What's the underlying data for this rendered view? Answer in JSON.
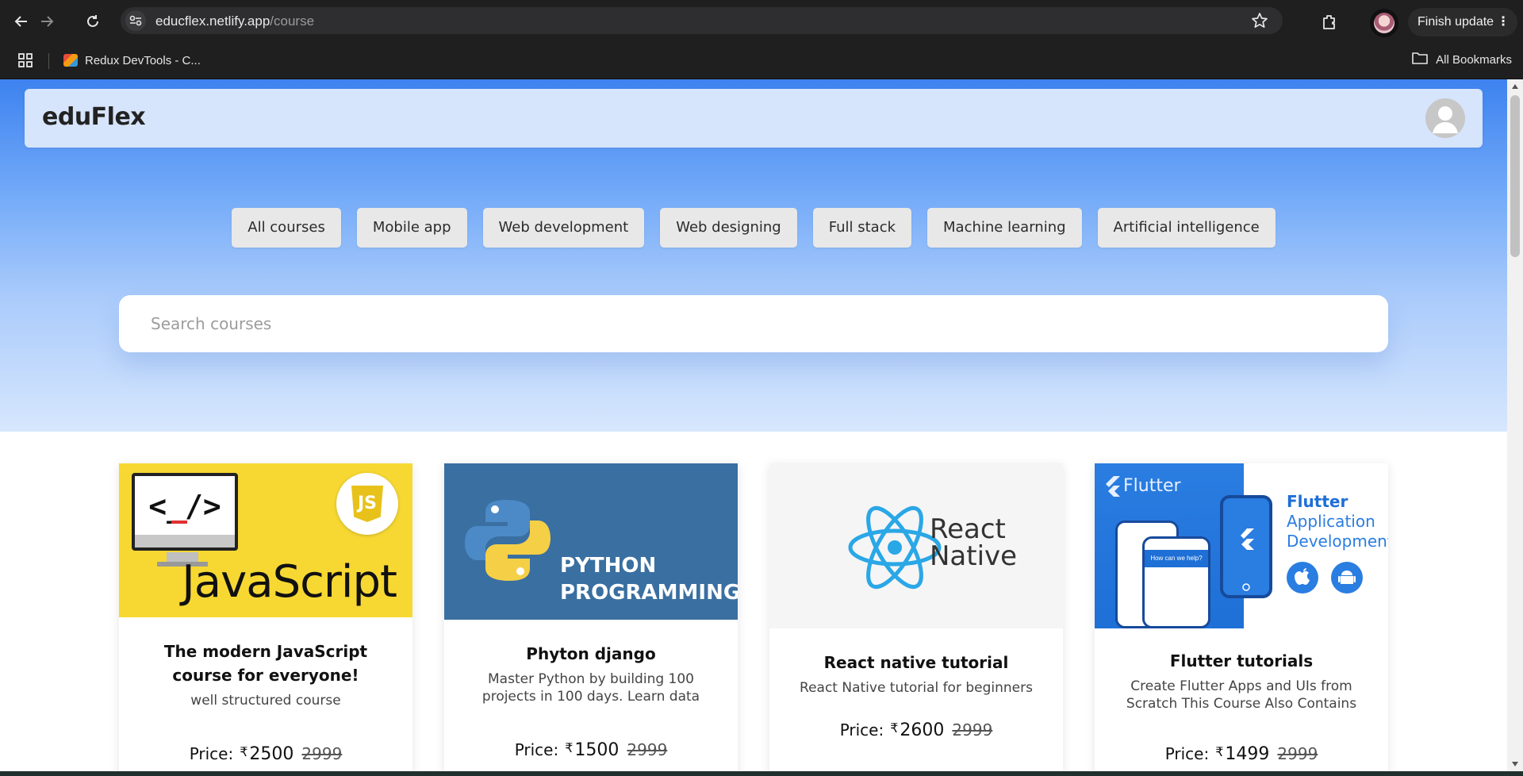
{
  "browser": {
    "url_host": "educflex.netlify.app",
    "url_path": "/course",
    "finish_update_label": "Finish update",
    "bookmark_item": "Redux DevTools - C...",
    "all_bookmarks_label": "All Bookmarks"
  },
  "header": {
    "brand": "eduFlex"
  },
  "categories": [
    "All courses",
    "Mobile app",
    "Web development",
    "Web designing",
    "Full stack",
    "Machine learning",
    "Artificial intelligence"
  ],
  "search": {
    "placeholder": "Search courses",
    "value": ""
  },
  "courses": [
    {
      "title": "The modern JavaScript course for everyone!",
      "description": "well structured course",
      "price_label": "Price:",
      "currency": "₹",
      "price": "2500",
      "old_price": "2999",
      "image": {
        "word": "JavaScript",
        "code": "<_/>",
        "badge": "JS"
      }
    },
    {
      "title": "Phyton django",
      "description": "Master Python by building 100 projects in 100 days. Learn data",
      "price_label": "Price:",
      "currency": "₹",
      "price": "1500",
      "old_price": "2999",
      "image": {
        "line1": "PYTHON",
        "line2": "PROGRAMMING"
      }
    },
    {
      "title": "React native tutorial",
      "description": "React Native tutorial for beginners",
      "price_label": "Price:",
      "currency": "₹",
      "price": "2600",
      "old_price": "2999",
      "image": {
        "line1": "React",
        "line2": "Native"
      }
    },
    {
      "title": "Flutter tutorials",
      "description": "Create Flutter Apps and UIs from Scratch This Course Also Contains",
      "price_label": "Price:",
      "currency": "₹",
      "price": "1499",
      "old_price": "2999",
      "image": {
        "brand": "Flutter",
        "heading1": "Flutter",
        "heading2": "Application",
        "heading3": "Development",
        "help": "How can we help?"
      }
    }
  ],
  "colors": {
    "hero_top": "#3d82ef",
    "hero_bottom": "#d7e7fd",
    "header_bar": "#d6e4fc",
    "chip_bg": "#e8e8e8"
  }
}
